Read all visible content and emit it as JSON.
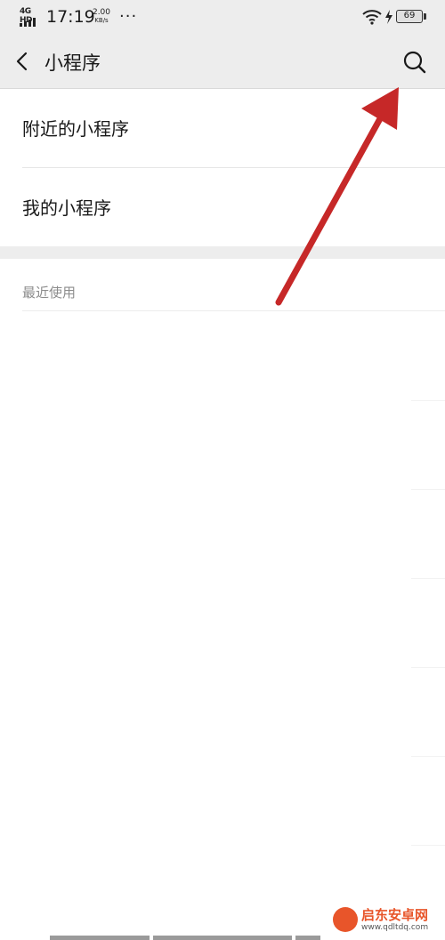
{
  "status_bar": {
    "network": "4G HD",
    "time": "17:19",
    "speed_value": "2.00",
    "speed_unit": "KB/s",
    "more": "···",
    "battery": "69"
  },
  "nav": {
    "title": "小程序",
    "back_icon": "chevron-left-icon",
    "search_icon": "search-icon"
  },
  "list": {
    "items": [
      {
        "label": "附近的小程序"
      },
      {
        "label": "我的小程序"
      }
    ],
    "recent_header": "最近使用"
  },
  "annotation": {
    "arrow_color": "#c62828"
  },
  "watermark": {
    "title": "启东安卓网",
    "url": "www.qdltdq.com"
  }
}
